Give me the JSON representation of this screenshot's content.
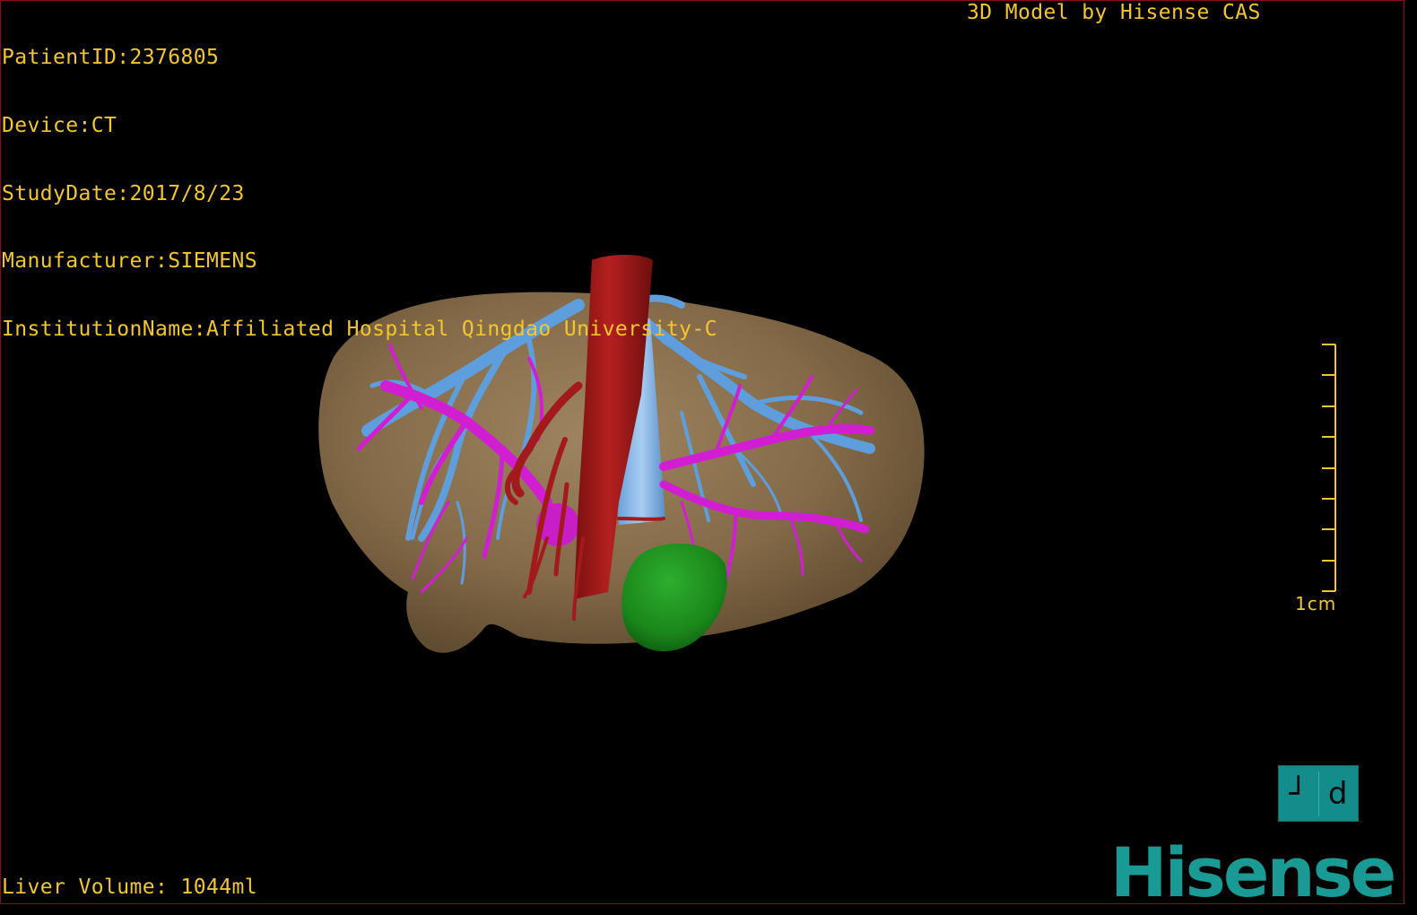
{
  "overlay": {
    "patient_id": "PatientID:2376805",
    "device": "Device:CT",
    "study_date": "StudyDate:2017/8/23",
    "manufacturer": "Manufacturer:SIEMENS",
    "institution": "InstitutionName:Affiliated Hospital Qingdao University-C",
    "model_credit": "3D Model by Hisense CAS",
    "liver_volume": "Liver Volume: 1044ml",
    "scale_label": "1cm"
  },
  "orientation_cube": {
    "left_glyph": "┘",
    "right_glyph": "d"
  },
  "branding": {
    "logo_text": "Hisense"
  },
  "colors": {
    "text": "#f2c630",
    "background": "#000000",
    "liver": "#8a6f4c",
    "hepatic_veins": "#5e9edc",
    "portal_vein": "#d21ed2",
    "artery_ivc": "#a31a1a",
    "tumor": "#1e8c1e",
    "logo": "#1a9a94"
  },
  "structures": [
    "liver",
    "hepatic-veins",
    "portal-vein",
    "artery",
    "inferior-vena-cava",
    "tumor"
  ]
}
